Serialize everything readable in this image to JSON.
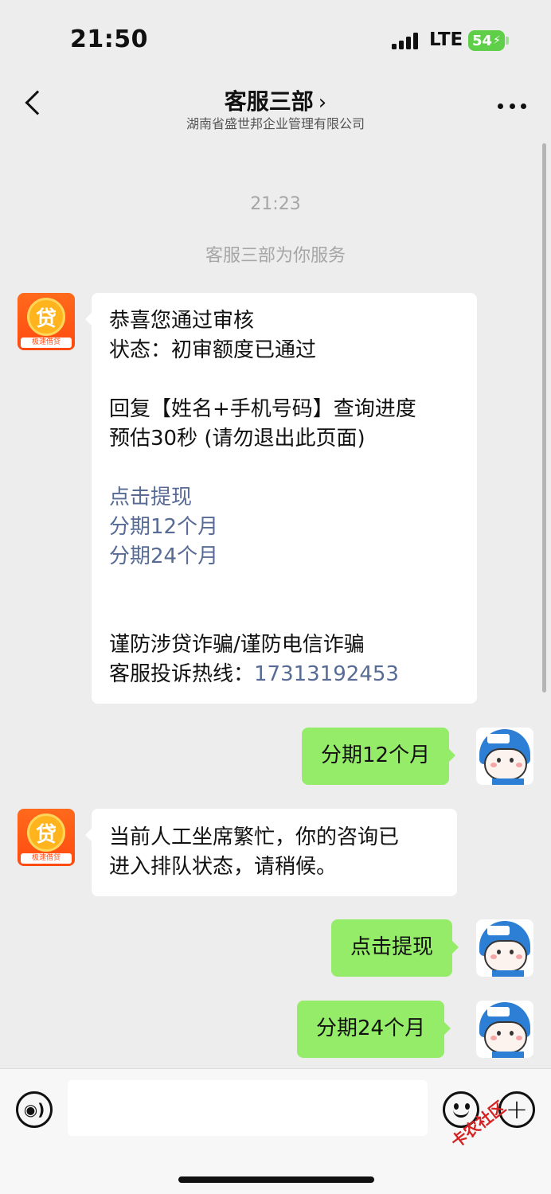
{
  "status_bar": {
    "time": "21:50",
    "network": "LTE",
    "battery": "54",
    "signal_bars": 4
  },
  "header": {
    "title": "客服三部",
    "subtitle": "湖南省盛世邦企业管理有限公司",
    "back_icon": "chevron-left-icon",
    "more_icon": "more-horizontal-icon"
  },
  "chat": {
    "system_time": "21:23",
    "system_note": "客服三部为你服务",
    "messages": [
      {
        "from": "bot",
        "avatar_text": "贷",
        "avatar_tag": "极速借贷",
        "lines": [
          {
            "text": "恭喜您通过审核",
            "type": "text"
          },
          {
            "text": "状态：初审额度已通过",
            "type": "text"
          },
          {
            "text": "",
            "type": "text"
          },
          {
            "text": "回复【姓名+手机号码】查询进度",
            "type": "text"
          },
          {
            "text": "预估30秒 (请勿退出此页面)",
            "type": "text"
          },
          {
            "text": "",
            "type": "text"
          },
          {
            "text": "点击提现",
            "type": "link"
          },
          {
            "text": "分期12个月",
            "type": "link"
          },
          {
            "text": "分期24个月",
            "type": "link"
          },
          {
            "text": "",
            "type": "text"
          },
          {
            "text": "",
            "type": "text"
          },
          {
            "text": "谨防涉贷诈骗/谨防电信诈骗",
            "type": "text"
          },
          {
            "text": "客服投诉热线：",
            "type": "text",
            "phone": "17313192453"
          }
        ]
      },
      {
        "from": "user",
        "text": "分期12个月"
      },
      {
        "from": "bot",
        "avatar_text": "贷",
        "avatar_tag": "极速借贷",
        "lines": [
          {
            "text": "当前人工坐席繁忙，你的咨询已",
            "type": "text"
          },
          {
            "text": "进入排队状态，请稍候。",
            "type": "text"
          }
        ]
      },
      {
        "from": "user",
        "text": "点击提现"
      },
      {
        "from": "user",
        "text": "分期24个月"
      }
    ]
  },
  "input_bar": {
    "voice_icon": "voice-icon",
    "placeholder": "",
    "emoji_icon": "emoji-icon",
    "plus_icon": "plus-icon"
  },
  "watermark": "卡农社区"
}
